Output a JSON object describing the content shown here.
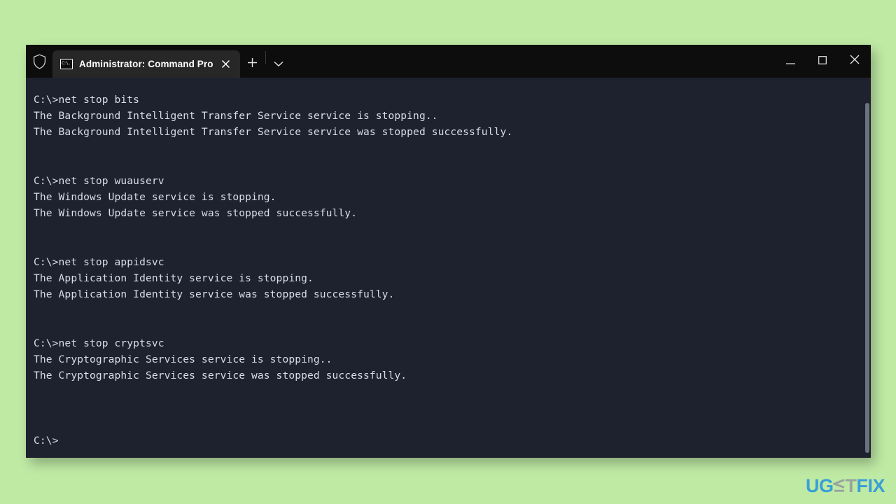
{
  "background_color": "#bfeaa4",
  "window": {
    "background_color": "#1d222e",
    "titlebar": {
      "background_color": "#0d0d0d",
      "shield_icon": "shield-icon",
      "tab": {
        "icon": "command-prompt-icon",
        "title": "Administrator: Command Pro",
        "close_icon": "close-icon",
        "background_color": "#272727"
      },
      "new_tab_icon": "plus-icon",
      "dropdown_icon": "chevron-down-icon",
      "controls": {
        "minimize_icon": "minimize-icon",
        "maximize_icon": "maximize-icon",
        "close_icon": "close-icon"
      }
    },
    "terminal": {
      "text_color": "#d8dee9",
      "content": "C:\\>net stop bits\nThe Background Intelligent Transfer Service service is stopping..\nThe Background Intelligent Transfer Service service was stopped successfully.\n\n\nC:\\>net stop wuauserv\nThe Windows Update service is stopping.\nThe Windows Update service was stopped successfully.\n\n\nC:\\>net stop appidsvc\nThe Application Identity service is stopping.\nThe Application Identity service was stopped successfully.\n\n\nC:\\>net stop cryptsvc\nThe Cryptographic Services service is stopping..\nThe Cryptographic Services service was stopped successfully.\n\n\n\nC:\\>",
      "lines": [
        "C:\\>net stop bits",
        "The Background Intelligent Transfer Service service is stopping..",
        "The Background Intelligent Transfer Service service was stopped successfully.",
        "",
        "",
        "C:\\>net stop wuauserv",
        "The Windows Update service is stopping.",
        "The Windows Update service was stopped successfully.",
        "",
        "",
        "C:\\>net stop appidsvc",
        "The Application Identity service is stopping.",
        "The Application Identity service was stopped successfully.",
        "",
        "",
        "C:\\>net stop cryptsvc",
        "The Cryptographic Services service is stopping..",
        "The Cryptographic Services service was stopped successfully.",
        "",
        "",
        "",
        "C:\\>"
      ],
      "scrollbar": "vertical-scrollbar"
    }
  },
  "watermark": {
    "part1": "UG",
    "part2": "T",
    "part3": "FIX",
    "blue": "#3a9fd6",
    "gray": "#9aa3a0"
  }
}
